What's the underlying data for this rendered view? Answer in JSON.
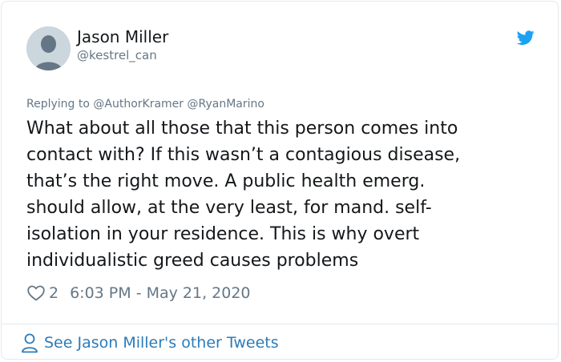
{
  "tweet": {
    "author": {
      "name": "Jason Miller",
      "handle": "@kestrel_can",
      "avatar_icon": "default-avatar-icon"
    },
    "brand_icon": "twitter-bird-icon",
    "brand_color": "#1da1f2",
    "replying_prefix": "Replying to",
    "replying_to": [
      "@AuthorKramer",
      "@RyanMarino"
    ],
    "text_lines": [
      "What about all those that this person comes into",
      "contact with?  If this wasn’t a contagious disease,",
      "that’s the right move.  A public health emerg.",
      "should allow, at the very least, for mand. self-",
      "isolation in your residence. This is why overt",
      "individualistic greed causes problems"
    ],
    "like_icon": "heart-icon",
    "like_count": "2",
    "timestamp": "6:03 PM - May 21, 2020"
  },
  "footer": {
    "icon": "person-icon",
    "link_label": "See Jason Miller's other Tweets",
    "link_color": "#2b7bb9"
  }
}
